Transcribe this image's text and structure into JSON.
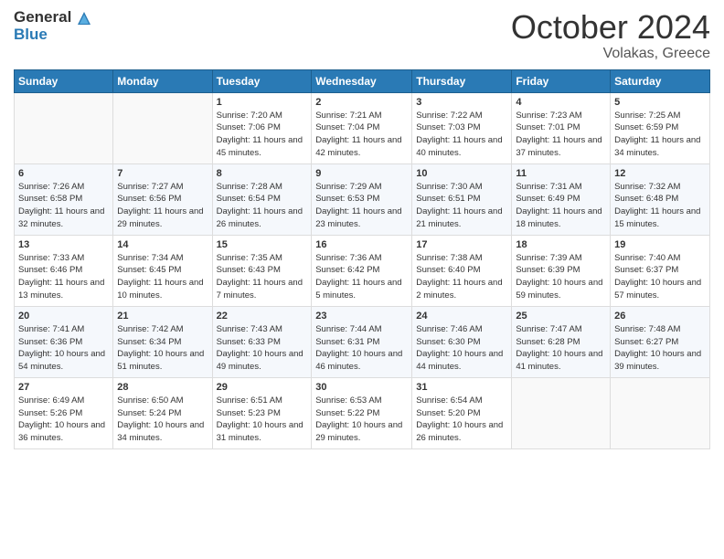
{
  "header": {
    "logo_general": "General",
    "logo_blue": "Blue",
    "title": "October 2024",
    "subtitle": "Volakas, Greece"
  },
  "columns": [
    "Sunday",
    "Monday",
    "Tuesday",
    "Wednesday",
    "Thursday",
    "Friday",
    "Saturday"
  ],
  "weeks": [
    [
      {
        "day": "",
        "info": ""
      },
      {
        "day": "",
        "info": ""
      },
      {
        "day": "1",
        "info": "Sunrise: 7:20 AM\nSunset: 7:06 PM\nDaylight: 11 hours and 45 minutes."
      },
      {
        "day": "2",
        "info": "Sunrise: 7:21 AM\nSunset: 7:04 PM\nDaylight: 11 hours and 42 minutes."
      },
      {
        "day": "3",
        "info": "Sunrise: 7:22 AM\nSunset: 7:03 PM\nDaylight: 11 hours and 40 minutes."
      },
      {
        "day": "4",
        "info": "Sunrise: 7:23 AM\nSunset: 7:01 PM\nDaylight: 11 hours and 37 minutes."
      },
      {
        "day": "5",
        "info": "Sunrise: 7:25 AM\nSunset: 6:59 PM\nDaylight: 11 hours and 34 minutes."
      }
    ],
    [
      {
        "day": "6",
        "info": "Sunrise: 7:26 AM\nSunset: 6:58 PM\nDaylight: 11 hours and 32 minutes."
      },
      {
        "day": "7",
        "info": "Sunrise: 7:27 AM\nSunset: 6:56 PM\nDaylight: 11 hours and 29 minutes."
      },
      {
        "day": "8",
        "info": "Sunrise: 7:28 AM\nSunset: 6:54 PM\nDaylight: 11 hours and 26 minutes."
      },
      {
        "day": "9",
        "info": "Sunrise: 7:29 AM\nSunset: 6:53 PM\nDaylight: 11 hours and 23 minutes."
      },
      {
        "day": "10",
        "info": "Sunrise: 7:30 AM\nSunset: 6:51 PM\nDaylight: 11 hours and 21 minutes."
      },
      {
        "day": "11",
        "info": "Sunrise: 7:31 AM\nSunset: 6:49 PM\nDaylight: 11 hours and 18 minutes."
      },
      {
        "day": "12",
        "info": "Sunrise: 7:32 AM\nSunset: 6:48 PM\nDaylight: 11 hours and 15 minutes."
      }
    ],
    [
      {
        "day": "13",
        "info": "Sunrise: 7:33 AM\nSunset: 6:46 PM\nDaylight: 11 hours and 13 minutes."
      },
      {
        "day": "14",
        "info": "Sunrise: 7:34 AM\nSunset: 6:45 PM\nDaylight: 11 hours and 10 minutes."
      },
      {
        "day": "15",
        "info": "Sunrise: 7:35 AM\nSunset: 6:43 PM\nDaylight: 11 hours and 7 minutes."
      },
      {
        "day": "16",
        "info": "Sunrise: 7:36 AM\nSunset: 6:42 PM\nDaylight: 11 hours and 5 minutes."
      },
      {
        "day": "17",
        "info": "Sunrise: 7:38 AM\nSunset: 6:40 PM\nDaylight: 11 hours and 2 minutes."
      },
      {
        "day": "18",
        "info": "Sunrise: 7:39 AM\nSunset: 6:39 PM\nDaylight: 10 hours and 59 minutes."
      },
      {
        "day": "19",
        "info": "Sunrise: 7:40 AM\nSunset: 6:37 PM\nDaylight: 10 hours and 57 minutes."
      }
    ],
    [
      {
        "day": "20",
        "info": "Sunrise: 7:41 AM\nSunset: 6:36 PM\nDaylight: 10 hours and 54 minutes."
      },
      {
        "day": "21",
        "info": "Sunrise: 7:42 AM\nSunset: 6:34 PM\nDaylight: 10 hours and 51 minutes."
      },
      {
        "day": "22",
        "info": "Sunrise: 7:43 AM\nSunset: 6:33 PM\nDaylight: 10 hours and 49 minutes."
      },
      {
        "day": "23",
        "info": "Sunrise: 7:44 AM\nSunset: 6:31 PM\nDaylight: 10 hours and 46 minutes."
      },
      {
        "day": "24",
        "info": "Sunrise: 7:46 AM\nSunset: 6:30 PM\nDaylight: 10 hours and 44 minutes."
      },
      {
        "day": "25",
        "info": "Sunrise: 7:47 AM\nSunset: 6:28 PM\nDaylight: 10 hours and 41 minutes."
      },
      {
        "day": "26",
        "info": "Sunrise: 7:48 AM\nSunset: 6:27 PM\nDaylight: 10 hours and 39 minutes."
      }
    ],
    [
      {
        "day": "27",
        "info": "Sunrise: 6:49 AM\nSunset: 5:26 PM\nDaylight: 10 hours and 36 minutes."
      },
      {
        "day": "28",
        "info": "Sunrise: 6:50 AM\nSunset: 5:24 PM\nDaylight: 10 hours and 34 minutes."
      },
      {
        "day": "29",
        "info": "Sunrise: 6:51 AM\nSunset: 5:23 PM\nDaylight: 10 hours and 31 minutes."
      },
      {
        "day": "30",
        "info": "Sunrise: 6:53 AM\nSunset: 5:22 PM\nDaylight: 10 hours and 29 minutes."
      },
      {
        "day": "31",
        "info": "Sunrise: 6:54 AM\nSunset: 5:20 PM\nDaylight: 10 hours and 26 minutes."
      },
      {
        "day": "",
        "info": ""
      },
      {
        "day": "",
        "info": ""
      }
    ]
  ]
}
